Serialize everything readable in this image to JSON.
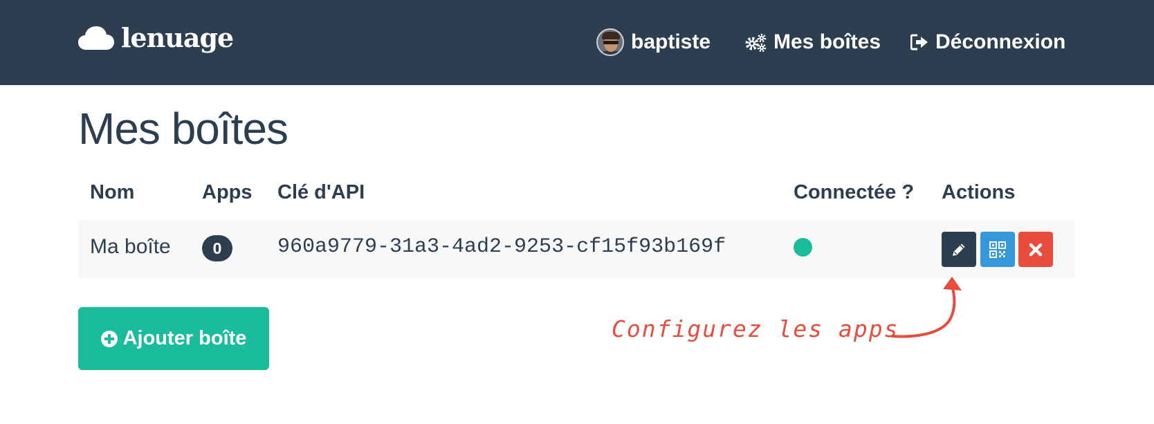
{
  "brand": {
    "name": "lenuage"
  },
  "nav": {
    "user_label": "baptiste",
    "boxes_label": "Mes boîtes",
    "logout_label": "Déconnexion"
  },
  "page": {
    "title": "Mes boîtes"
  },
  "table": {
    "headers": [
      "Nom",
      "Apps",
      "Clé d'API",
      "Connectée ?",
      "Actions"
    ],
    "rows": [
      {
        "name": "Ma boîte",
        "apps": "0",
        "api_key": "960a9779-31a3-4ad2-9253-cf15f93b169f",
        "connected": true
      }
    ]
  },
  "actions": {
    "add_box_label": "Ajouter boîte"
  },
  "annotation": {
    "text": "Configurez les apps"
  },
  "icons": {
    "brand": "cloud-icon",
    "user": "avatar",
    "boxes": "gears-icon",
    "logout": "sign-out-icon",
    "edit": "pencil-icon",
    "qr": "qrcode-icon",
    "delete": "times-icon",
    "add": "plus-circle-icon"
  },
  "colors": {
    "navbar": "#2c3e50",
    "primary": "#2c3e50",
    "success": "#1abc9c",
    "info": "#3498db",
    "danger": "#e74c3c",
    "row_bg": "#f8f8f8"
  }
}
